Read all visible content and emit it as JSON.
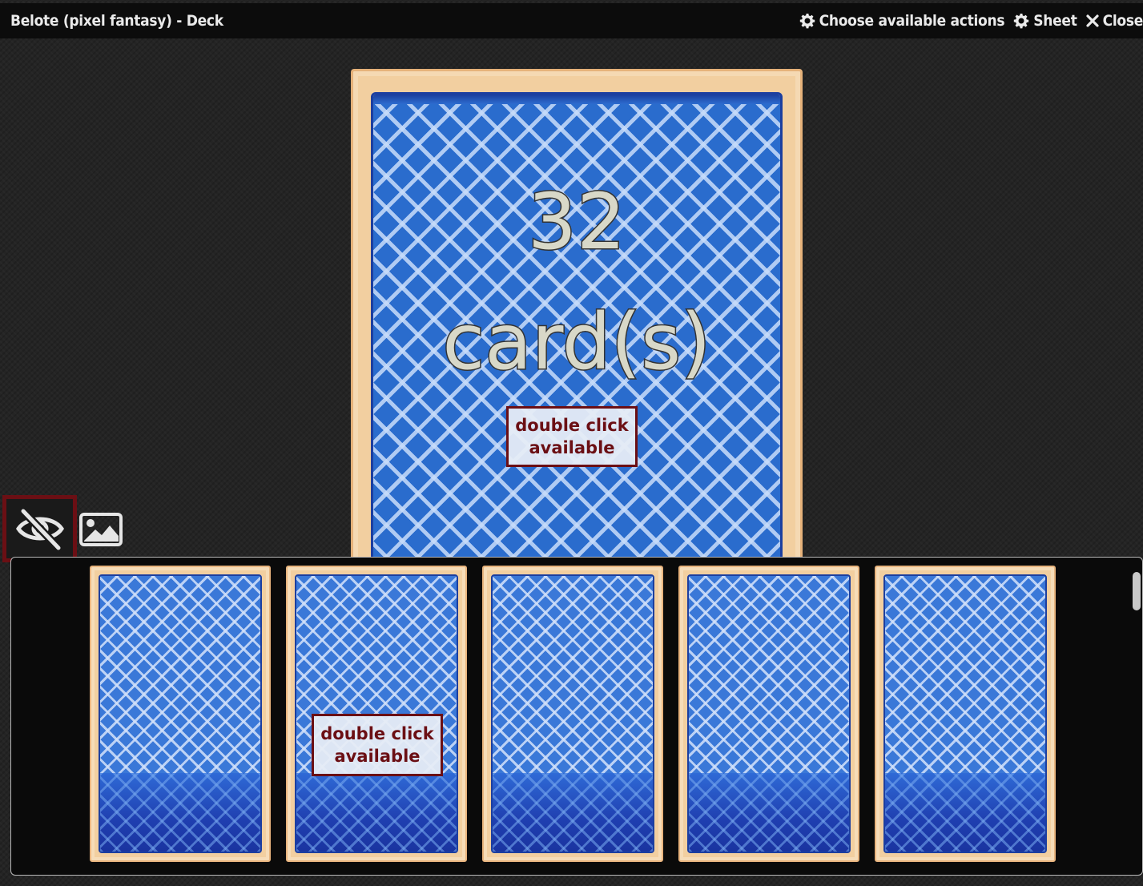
{
  "window": {
    "title": "Belote (pixel fantasy) - Deck",
    "actions": {
      "choose_actions": "Choose available actions",
      "sheet": "Sheet",
      "close": "Close"
    }
  },
  "deck": {
    "count": "32",
    "unit": "card(s)",
    "hint_line1": "double click",
    "hint_line2": "available"
  },
  "tools": {
    "visibility_icon": "eye-slash-icon",
    "image_icon": "image-icon"
  },
  "hand": {
    "card_count": 5,
    "hint_line1": "double click",
    "hint_line2": "available"
  },
  "colors": {
    "card_border": "#f2cfa0",
    "card_back_blue": "#2a6ccd",
    "hint_border": "#6b0f14",
    "title_bar": "#0c0c0c"
  }
}
